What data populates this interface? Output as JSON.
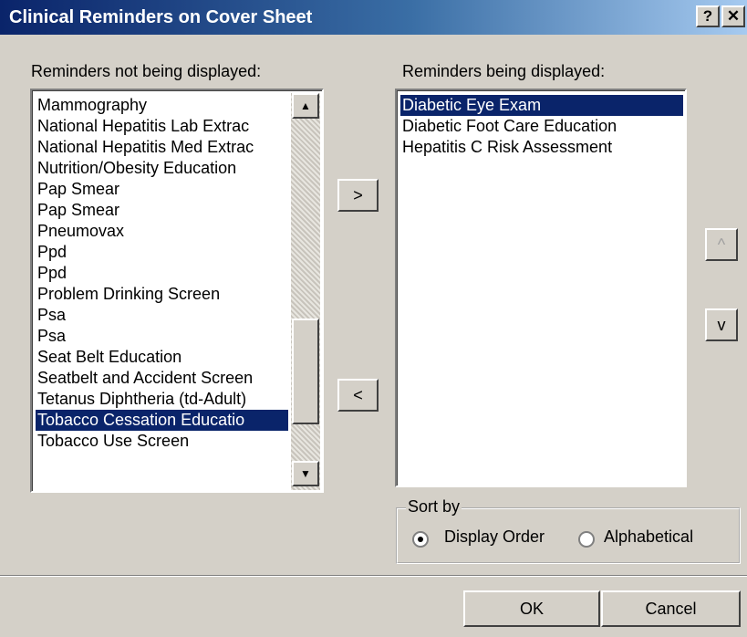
{
  "window": {
    "title": "Clinical Reminders on Cover Sheet",
    "help_label": "?",
    "close_label": "✕"
  },
  "left_list": {
    "label": "Reminders not being displayed:",
    "items": [
      {
        "label": "Mammography",
        "selected": false
      },
      {
        "label": "National Hepatitis Lab Extrac",
        "selected": false
      },
      {
        "label": "National Hepatitis Med Extrac",
        "selected": false
      },
      {
        "label": "Nutrition/Obesity Education",
        "selected": false
      },
      {
        "label": "Pap Smear",
        "selected": false
      },
      {
        "label": "Pap Smear",
        "selected": false
      },
      {
        "label": "Pneumovax",
        "selected": false
      },
      {
        "label": "Ppd",
        "selected": false
      },
      {
        "label": "Ppd",
        "selected": false
      },
      {
        "label": "Problem Drinking Screen",
        "selected": false
      },
      {
        "label": "Psa",
        "selected": false
      },
      {
        "label": "Psa",
        "selected": false
      },
      {
        "label": "Seat Belt Education",
        "selected": false
      },
      {
        "label": "Seatbelt and Accident Screen",
        "selected": false
      },
      {
        "label": "Tetanus Diphtheria (td-Adult)",
        "selected": false
      },
      {
        "label": "Tobacco Cessation Educatio",
        "selected": true
      },
      {
        "label": "Tobacco Use Screen",
        "selected": false
      }
    ]
  },
  "right_list": {
    "label": "Reminders being displayed:",
    "items": [
      {
        "label": "Diabetic Eye Exam",
        "selected": true
      },
      {
        "label": "Diabetic Foot Care Education",
        "selected": false
      },
      {
        "label": "Hepatitis C Risk Assessment",
        "selected": false
      }
    ]
  },
  "move_buttons": {
    "add_label": ">",
    "remove_label": "<"
  },
  "order_buttons": {
    "up_label": "^",
    "down_label": "v"
  },
  "sort": {
    "legend": "Sort by",
    "options": [
      {
        "label": "Display Order",
        "checked": true
      },
      {
        "label": "Alphabetical",
        "checked": false
      }
    ]
  },
  "footer": {
    "ok_label": "OK",
    "cancel_label": "Cancel"
  },
  "colors": {
    "title_gradient_start": "#0a246a",
    "selection": "#0a246a",
    "face": "#d4d0c8"
  }
}
